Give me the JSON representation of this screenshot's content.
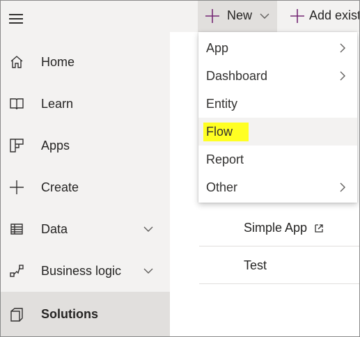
{
  "sidebar": {
    "menu_icon": "hamburger-icon",
    "items": [
      {
        "label": "Home",
        "icon": "home-icon"
      },
      {
        "label": "Learn",
        "icon": "book-icon"
      },
      {
        "label": "Apps",
        "icon": "apps-icon"
      },
      {
        "label": "Create",
        "icon": "plus-icon"
      },
      {
        "label": "Data",
        "icon": "table-icon",
        "expandable": true
      },
      {
        "label": "Business logic",
        "icon": "flow-logic-icon",
        "expandable": true
      },
      {
        "label": "Solutions",
        "icon": "solutions-icon",
        "selected": true
      }
    ]
  },
  "toolbar": {
    "new_label": "New",
    "add_existing_label": "Add exist"
  },
  "menu": {
    "items": [
      {
        "label": "App",
        "submenu": true
      },
      {
        "label": "Dashboard",
        "submenu": true
      },
      {
        "label": "Entity",
        "submenu": false
      },
      {
        "label": "Flow",
        "submenu": false,
        "highlighted": true
      },
      {
        "label": "Report",
        "submenu": false
      },
      {
        "label": "Other",
        "submenu": true
      }
    ]
  },
  "list": {
    "rows": [
      {
        "name": "Simple App",
        "external_link": true
      },
      {
        "name": "Test",
        "external_link": false
      }
    ]
  },
  "colors": {
    "sidebar_bg": "#f3f2f1",
    "selected_bg": "#e1dfdd",
    "highlight": "#ffff22",
    "accent_plus": "#742774"
  }
}
